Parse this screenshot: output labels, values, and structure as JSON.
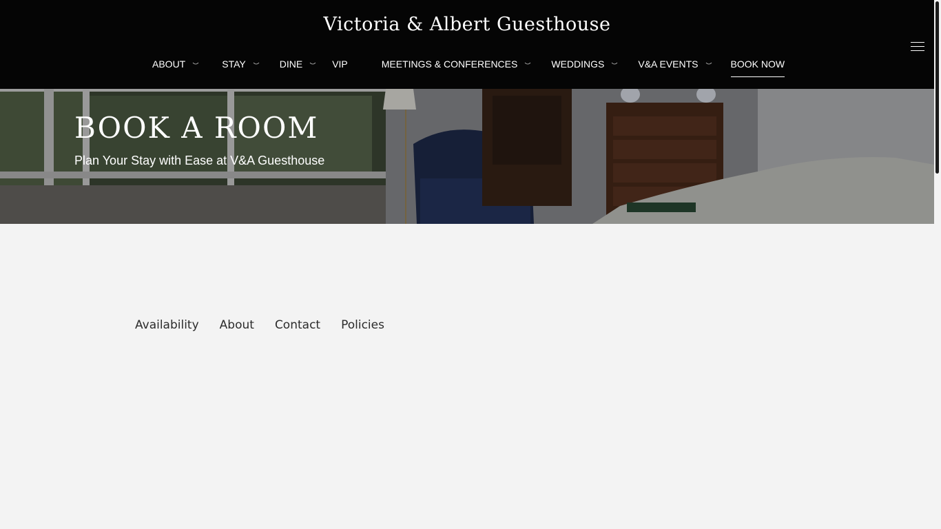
{
  "header": {
    "brand": "Victoria & Albert Guesthouse",
    "nav": [
      {
        "label": "ABOUT",
        "has_dropdown": true
      },
      {
        "label": "STAY",
        "has_dropdown": true
      },
      {
        "label": "DINE",
        "has_dropdown": true
      },
      {
        "label": "VIP",
        "has_dropdown": false
      },
      {
        "label": "MEETINGS & CONFERENCES",
        "has_dropdown": true
      },
      {
        "label": "WEDDINGS",
        "has_dropdown": true
      },
      {
        "label": "V&A EVENTS",
        "has_dropdown": true
      },
      {
        "label": "BOOK NOW",
        "has_dropdown": false,
        "active": true
      }
    ],
    "menu_icon": "hamburger-icon"
  },
  "hero": {
    "title": "BOOK A ROOM",
    "subtitle": "Plan Your Stay with Ease at V&A Guesthouse"
  },
  "tabs": [
    {
      "label": "Availability"
    },
    {
      "label": "About"
    },
    {
      "label": "Contact"
    },
    {
      "label": "Policies"
    }
  ],
  "colors": {
    "header_bg": "#050505",
    "page_bg": "#f3f3f3",
    "text_light": "#ffffff",
    "tab_text": "#2b2b2b"
  }
}
